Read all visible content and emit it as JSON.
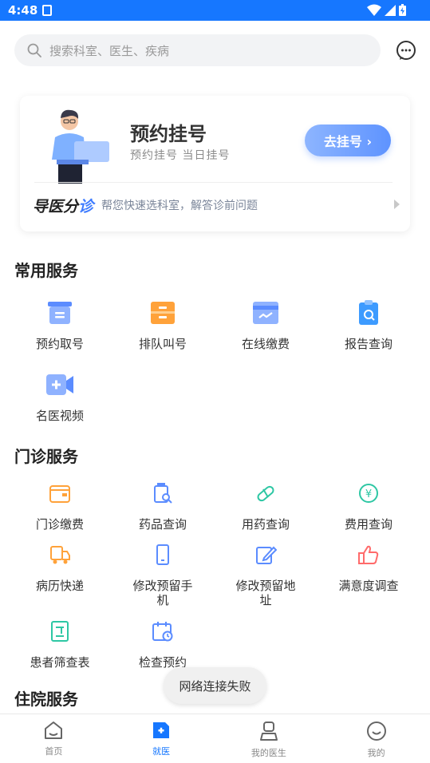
{
  "status_bar": {
    "time": "4:48"
  },
  "search": {
    "placeholder": "搜索科室、医生、疾病"
  },
  "appointment": {
    "title": "预约挂号",
    "subtitle": "预约挂号   当日挂号",
    "button_label": "去挂号 ›",
    "guide_title_prefix": "导医分",
    "guide_title_accent": "诊",
    "guide_desc": "帮您快速选科室，解答诊前问题"
  },
  "common_services": {
    "title": "常用服务",
    "items": [
      {
        "label": "预约取号",
        "icon": "ticket-machine-icon",
        "color": "#5b8cff"
      },
      {
        "label": "排队叫号",
        "icon": "queue-ticket-icon",
        "color": "#ff9a3c"
      },
      {
        "label": "在线缴费",
        "icon": "payment-card-icon",
        "color": "#5b8cff"
      },
      {
        "label": "报告查询",
        "icon": "report-search-icon",
        "color": "#3d9bff"
      },
      {
        "label": "名医视频",
        "icon": "video-camera-icon",
        "color": "#5b8cff"
      }
    ]
  },
  "outpatient_services": {
    "title": "门诊服务",
    "items": [
      {
        "label": "门诊缴费",
        "icon": "wallet-icon",
        "color": "#ffa23a"
      },
      {
        "label": "药品查询",
        "icon": "medicine-search-icon",
        "color": "#5b8cff"
      },
      {
        "label": "用药查询",
        "icon": "pill-icon",
        "color": "#2ec7a4"
      },
      {
        "label": "费用查询",
        "icon": "fee-yen-icon",
        "color": "#2ec7a4"
      },
      {
        "label": "病历快递",
        "icon": "delivery-truck-icon",
        "color": "#ffa23a"
      },
      {
        "label": "修改预留手机",
        "icon": "mobile-phone-icon",
        "color": "#5b8cff"
      },
      {
        "label": "修改预留地址",
        "icon": "edit-address-icon",
        "color": "#5b8cff"
      },
      {
        "label": "满意度调查",
        "icon": "thumbs-up-icon",
        "color": "#ff6b6b"
      },
      {
        "label": "患者筛查表",
        "icon": "screening-form-icon",
        "color": "#2ec7a4"
      },
      {
        "label": "检查预约",
        "icon": "calendar-clock-icon",
        "color": "#5b8cff"
      }
    ]
  },
  "inpatient_services": {
    "title": "住院服务"
  },
  "toast": {
    "text": "网络连接失败"
  },
  "tabbar": {
    "items": [
      {
        "label": "首页",
        "icon": "home-icon",
        "active": false
      },
      {
        "label": "就医",
        "icon": "medical-plus-icon",
        "active": true
      },
      {
        "label": "我的医生",
        "icon": "doctor-icon",
        "active": false
      },
      {
        "label": "我的",
        "icon": "smile-profile-icon",
        "active": false
      }
    ]
  },
  "colors": {
    "primary": "#1677ff",
    "button_gradient_start": "#8db5ff",
    "button_gradient_end": "#5e93ff"
  }
}
